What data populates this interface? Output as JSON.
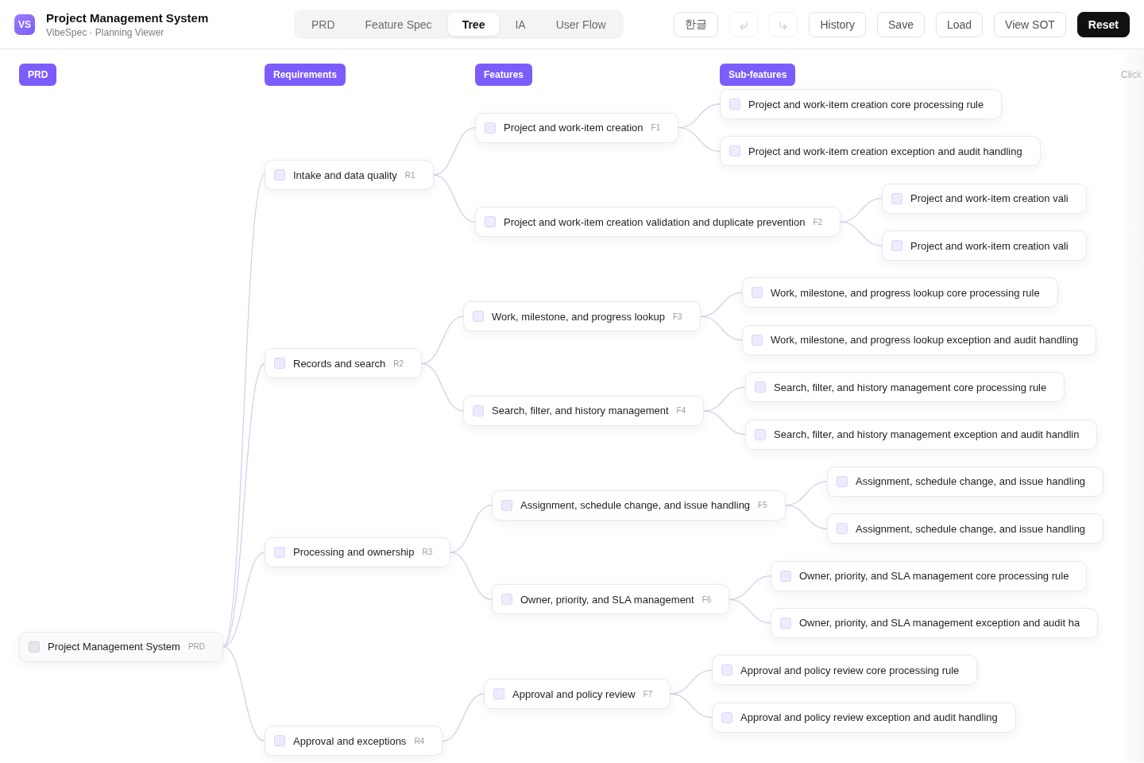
{
  "app": {
    "logo": "VS",
    "title": "Project Management System",
    "subtitle": "VibeSpec · Planning Viewer"
  },
  "tabs": [
    {
      "label": "PRD",
      "selected": false
    },
    {
      "label": "Feature Spec",
      "selected": false
    },
    {
      "label": "Tree",
      "selected": true
    },
    {
      "label": "IA",
      "selected": false
    },
    {
      "label": "User Flow",
      "selected": false
    }
  ],
  "toolbar": [
    {
      "kind": "text",
      "label": "한글"
    },
    {
      "kind": "undo",
      "disabled": true
    },
    {
      "kind": "redo",
      "disabled": true
    },
    {
      "kind": "text",
      "label": "History"
    },
    {
      "kind": "text",
      "label": "Save"
    },
    {
      "kind": "text",
      "label": "Load"
    },
    {
      "kind": "text",
      "label": "View SOT"
    },
    {
      "kind": "primary",
      "label": "Reset"
    }
  ],
  "columns": [
    "PRD",
    "Requirements",
    "Features",
    "Sub-features"
  ],
  "hint": "Click",
  "tree": {
    "label": "Project Management System",
    "code": "PRD",
    "checked": false,
    "children": [
      {
        "label": "Intake and data quality",
        "code": "R1",
        "checked": false,
        "children": [
          {
            "label": "Project and work-item creation",
            "code": "F1",
            "checked": false,
            "children": [
              {
                "label": "Project and work-item creation core processing rule",
                "checked": false
              },
              {
                "label": "Project and work-item creation exception and audit handling",
                "checked": false
              }
            ]
          },
          {
            "label": "Project and work-item creation validation and duplicate prevention",
            "code": "F2",
            "checked": false,
            "children": [
              {
                "label": "Project and work-item creation vali",
                "checked": false
              },
              {
                "label": "Project and work-item creation vali",
                "checked": false
              }
            ]
          }
        ]
      },
      {
        "label": "Records and search",
        "code": "R2",
        "checked": false,
        "children": [
          {
            "label": "Work, milestone, and progress lookup",
            "code": "F3",
            "checked": false,
            "children": [
              {
                "label": "Work, milestone, and progress lookup core processing rule",
                "checked": false
              },
              {
                "label": "Work, milestone, and progress lookup exception and audit handling",
                "checked": false
              }
            ]
          },
          {
            "label": "Search, filter, and history management",
            "code": "F4",
            "checked": false,
            "children": [
              {
                "label": "Search, filter, and history management core processing rule",
                "checked": false
              },
              {
                "label": "Search, filter, and history management exception and audit handlin",
                "checked": false
              }
            ]
          }
        ]
      },
      {
        "label": "Processing and ownership",
        "code": "R3",
        "checked": false,
        "children": [
          {
            "label": "Assignment, schedule change, and issue handling",
            "code": "F5",
            "checked": false,
            "children": [
              {
                "label": "Assignment, schedule change, and issue handling",
                "checked": false
              },
              {
                "label": "Assignment, schedule change, and issue handling",
                "checked": false
              }
            ]
          },
          {
            "label": "Owner, priority, and SLA management",
            "code": "F6",
            "checked": false,
            "children": [
              {
                "label": "Owner, priority, and SLA management core processing rule",
                "checked": false
              },
              {
                "label": "Owner, priority, and SLA management exception and audit ha",
                "checked": false
              }
            ]
          }
        ]
      },
      {
        "label": "Approval and exceptions",
        "code": "R4",
        "checked": false,
        "children": [
          {
            "label": "Approval and policy review",
            "code": "F7",
            "checked": false,
            "children": [
              {
                "label": "Approval and policy review core processing rule",
                "checked": false
              },
              {
                "label": "Approval and policy review exception and audit handling",
                "checked": false
              }
            ]
          }
        ]
      }
    ]
  }
}
